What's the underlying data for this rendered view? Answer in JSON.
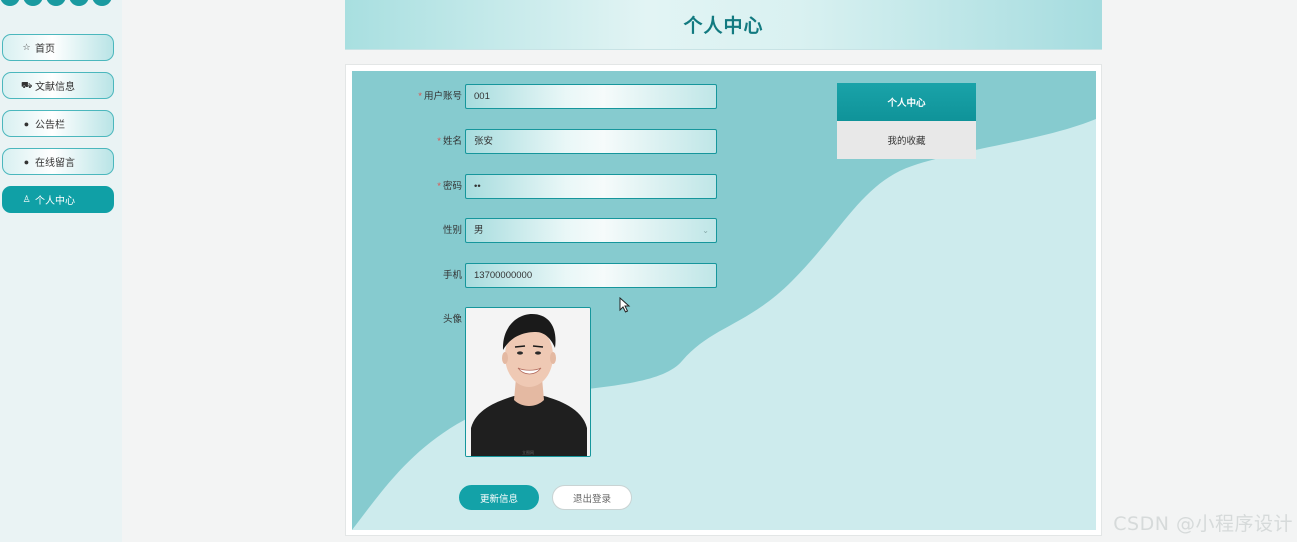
{
  "sidebar": {
    "items": [
      {
        "label": "首页",
        "icon": "star-icon",
        "active": false
      },
      {
        "label": "文献信息",
        "icon": "bag-icon",
        "active": false
      },
      {
        "label": "公告栏",
        "icon": "info-icon",
        "active": false
      },
      {
        "label": "在线留言",
        "icon": "help-icon",
        "active": false
      },
      {
        "label": "个人中心",
        "icon": "user-icon",
        "active": true
      }
    ]
  },
  "header": {
    "title": "个人中心"
  },
  "form": {
    "account": {
      "label": "用户账号",
      "value": "001",
      "required": true
    },
    "name": {
      "label": "姓名",
      "value": "张安",
      "required": true
    },
    "password": {
      "label": "密码",
      "value": "••",
      "required": true
    },
    "gender": {
      "label": "性别",
      "value": "男"
    },
    "phone": {
      "label": "手机",
      "value": "13700000000"
    },
    "avatar": {
      "label": "头像",
      "caption": "立图网"
    }
  },
  "buttons": {
    "update": "更新信息",
    "logout": "退出登录"
  },
  "tabs": [
    {
      "label": "个人中心",
      "active": true
    },
    {
      "label": "我的收藏",
      "active": false
    }
  ],
  "watermark": "CSDN @小程序设计",
  "colors": {
    "accent": "#10a0a6",
    "header_title": "#127a80",
    "panel_bg": "#86cbcf",
    "wave_light": "#cdebed"
  }
}
